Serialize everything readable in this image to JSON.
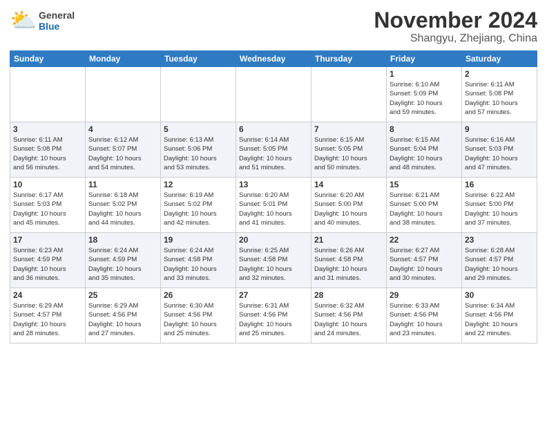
{
  "header": {
    "logo": {
      "general": "General",
      "blue": "Blue"
    },
    "title": "November 2024",
    "location": "Shangyu, Zhejiang, China"
  },
  "weekdays": [
    "Sunday",
    "Monday",
    "Tuesday",
    "Wednesday",
    "Thursday",
    "Friday",
    "Saturday"
  ],
  "weeks": [
    [
      {
        "day": "",
        "info": ""
      },
      {
        "day": "",
        "info": ""
      },
      {
        "day": "",
        "info": ""
      },
      {
        "day": "",
        "info": ""
      },
      {
        "day": "",
        "info": ""
      },
      {
        "day": "1",
        "info": "Sunrise: 6:10 AM\nSunset: 5:09 PM\nDaylight: 10 hours\nand 59 minutes."
      },
      {
        "day": "2",
        "info": "Sunrise: 6:11 AM\nSunset: 5:08 PM\nDaylight: 10 hours\nand 57 minutes."
      }
    ],
    [
      {
        "day": "3",
        "info": "Sunrise: 6:11 AM\nSunset: 5:08 PM\nDaylight: 10 hours\nand 56 minutes."
      },
      {
        "day": "4",
        "info": "Sunrise: 6:12 AM\nSunset: 5:07 PM\nDaylight: 10 hours\nand 54 minutes."
      },
      {
        "day": "5",
        "info": "Sunrise: 6:13 AM\nSunset: 5:06 PM\nDaylight: 10 hours\nand 53 minutes."
      },
      {
        "day": "6",
        "info": "Sunrise: 6:14 AM\nSunset: 5:05 PM\nDaylight: 10 hours\nand 51 minutes."
      },
      {
        "day": "7",
        "info": "Sunrise: 6:15 AM\nSunset: 5:05 PM\nDaylight: 10 hours\nand 50 minutes."
      },
      {
        "day": "8",
        "info": "Sunrise: 6:15 AM\nSunset: 5:04 PM\nDaylight: 10 hours\nand 48 minutes."
      },
      {
        "day": "9",
        "info": "Sunrise: 6:16 AM\nSunset: 5:03 PM\nDaylight: 10 hours\nand 47 minutes."
      }
    ],
    [
      {
        "day": "10",
        "info": "Sunrise: 6:17 AM\nSunset: 5:03 PM\nDaylight: 10 hours\nand 45 minutes."
      },
      {
        "day": "11",
        "info": "Sunrise: 6:18 AM\nSunset: 5:02 PM\nDaylight: 10 hours\nand 44 minutes."
      },
      {
        "day": "12",
        "info": "Sunrise: 6:19 AM\nSunset: 5:02 PM\nDaylight: 10 hours\nand 42 minutes."
      },
      {
        "day": "13",
        "info": "Sunrise: 6:20 AM\nSunset: 5:01 PM\nDaylight: 10 hours\nand 41 minutes."
      },
      {
        "day": "14",
        "info": "Sunrise: 6:20 AM\nSunset: 5:00 PM\nDaylight: 10 hours\nand 40 minutes."
      },
      {
        "day": "15",
        "info": "Sunrise: 6:21 AM\nSunset: 5:00 PM\nDaylight: 10 hours\nand 38 minutes."
      },
      {
        "day": "16",
        "info": "Sunrise: 6:22 AM\nSunset: 5:00 PM\nDaylight: 10 hours\nand 37 minutes."
      }
    ],
    [
      {
        "day": "17",
        "info": "Sunrise: 6:23 AM\nSunset: 4:59 PM\nDaylight: 10 hours\nand 36 minutes."
      },
      {
        "day": "18",
        "info": "Sunrise: 6:24 AM\nSunset: 4:59 PM\nDaylight: 10 hours\nand 35 minutes."
      },
      {
        "day": "19",
        "info": "Sunrise: 6:24 AM\nSunset: 4:58 PM\nDaylight: 10 hours\nand 33 minutes."
      },
      {
        "day": "20",
        "info": "Sunrise: 6:25 AM\nSunset: 4:58 PM\nDaylight: 10 hours\nand 32 minutes."
      },
      {
        "day": "21",
        "info": "Sunrise: 6:26 AM\nSunset: 4:58 PM\nDaylight: 10 hours\nand 31 minutes."
      },
      {
        "day": "22",
        "info": "Sunrise: 6:27 AM\nSunset: 4:57 PM\nDaylight: 10 hours\nand 30 minutes."
      },
      {
        "day": "23",
        "info": "Sunrise: 6:28 AM\nSunset: 4:57 PM\nDaylight: 10 hours\nand 29 minutes."
      }
    ],
    [
      {
        "day": "24",
        "info": "Sunrise: 6:29 AM\nSunset: 4:57 PM\nDaylight: 10 hours\nand 28 minutes."
      },
      {
        "day": "25",
        "info": "Sunrise: 6:29 AM\nSunset: 4:56 PM\nDaylight: 10 hours\nand 27 minutes."
      },
      {
        "day": "26",
        "info": "Sunrise: 6:30 AM\nSunset: 4:56 PM\nDaylight: 10 hours\nand 25 minutes."
      },
      {
        "day": "27",
        "info": "Sunrise: 6:31 AM\nSunset: 4:56 PM\nDaylight: 10 hours\nand 25 minutes."
      },
      {
        "day": "28",
        "info": "Sunrise: 6:32 AM\nSunset: 4:56 PM\nDaylight: 10 hours\nand 24 minutes."
      },
      {
        "day": "29",
        "info": "Sunrise: 6:33 AM\nSunset: 4:56 PM\nDaylight: 10 hours\nand 23 minutes."
      },
      {
        "day": "30",
        "info": "Sunrise: 6:34 AM\nSunset: 4:56 PM\nDaylight: 10 hours\nand 22 minutes."
      }
    ]
  ]
}
